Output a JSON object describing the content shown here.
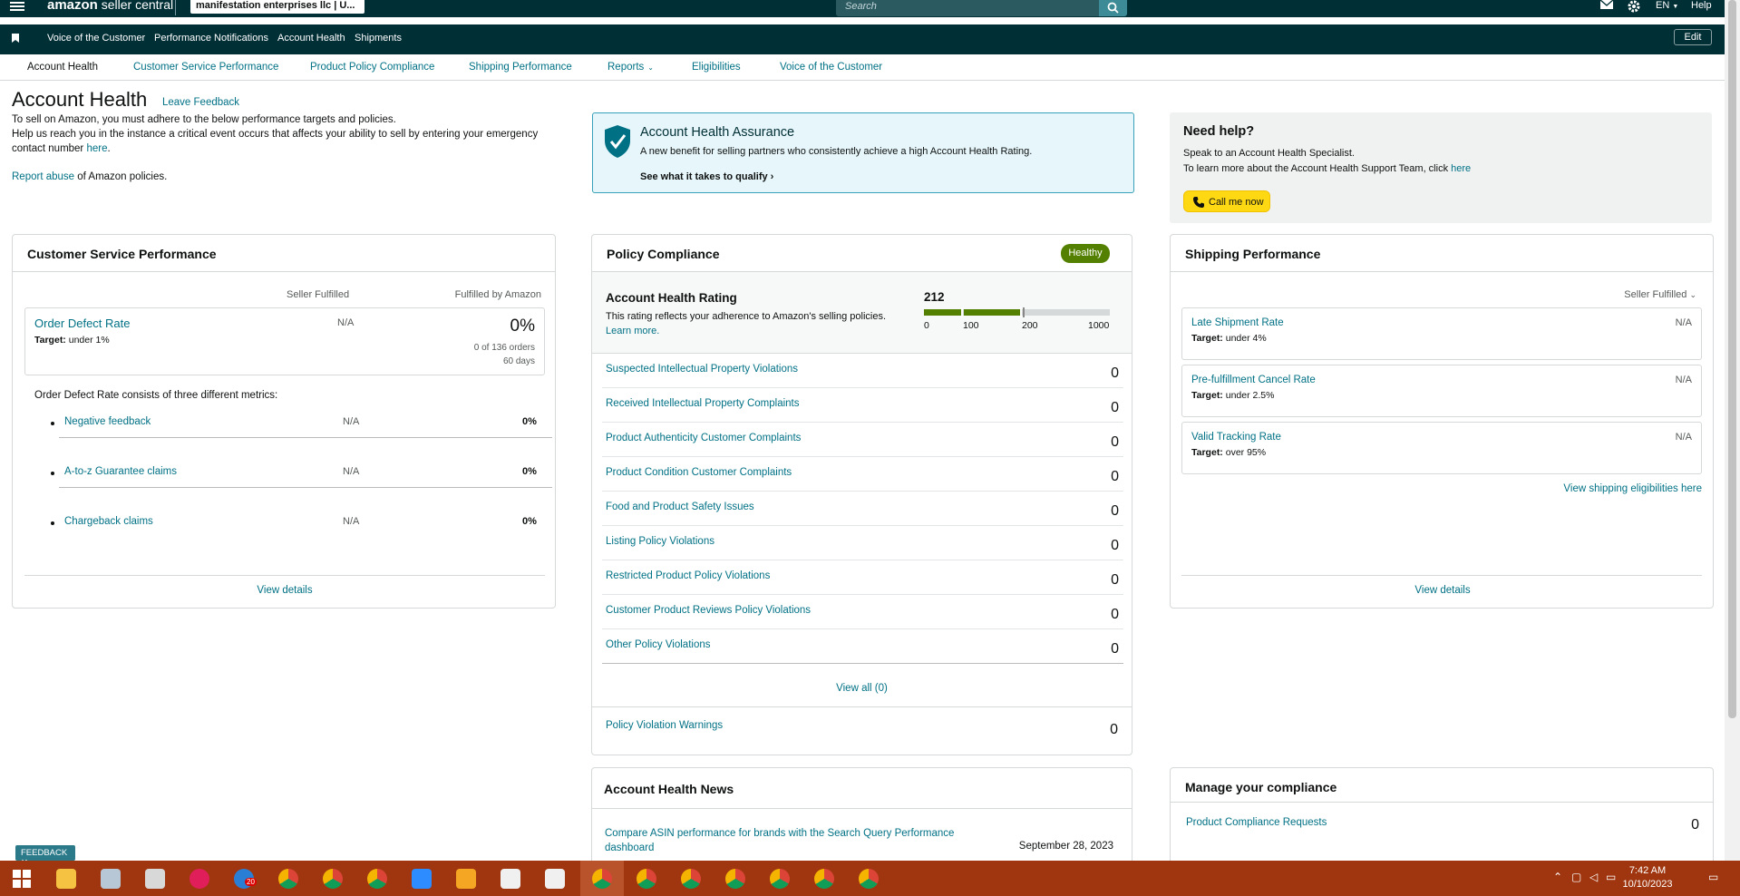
{
  "topbar": {
    "brand": "amazon",
    "brand_suffix": " seller central",
    "account": "manifestation enterprises llc | U...",
    "search_placeholder": "Search",
    "language": "EN",
    "help": "Help"
  },
  "subnav": {
    "items": [
      "Voice of the Customer",
      "Performance Notifications",
      "Account Health",
      "Shipments"
    ],
    "edit": "Edit"
  },
  "tabs": {
    "items": [
      "Account Health",
      "Customer Service Performance",
      "Product Policy Compliance",
      "Shipping Performance",
      "Reports",
      "Eligibilities",
      "Voice of the Customer"
    ]
  },
  "header": {
    "title": "Account Health",
    "leave_feedback": "Leave Feedback",
    "intro1": "To sell on Amazon, you must adhere to the below performance targets and policies.",
    "intro2": "Help us reach you in the instance a critical event occurs that affects your ability to sell by entering your emergency contact number ",
    "intro2_link": "here",
    "intro2_end": ".",
    "report_abuse_link": "Report abuse",
    "report_abuse_rest": " of Amazon policies."
  },
  "assurance": {
    "title": "Account Health Assurance",
    "desc": "A new benefit for selling partners who consistently achieve a high Account Health Rating.",
    "link": "See what it takes to qualify"
  },
  "needhelp": {
    "title": "Need help?",
    "line1": "Speak to an Account Health Specialist.",
    "line2": "To learn more about the Account Health Support Team, click ",
    "line2_link": "here",
    "call": "Call me now"
  },
  "csp": {
    "title": "Customer Service Performance",
    "col_seller": "Seller Fulfilled",
    "col_fba": "Fulfilled by Amazon",
    "odr_name": "Order Defect Rate",
    "odr_target_label": "Target:",
    "odr_target": " under 1%",
    "odr_na": "N/A",
    "odr_pct": "0%",
    "odr_orders": "0 of 136 orders",
    "odr_days": "60 days",
    "consists": "Order Defect Rate consists of three different metrics:",
    "metrics": [
      {
        "name": "Negative feedback",
        "seller": "N/A",
        "fba": "0%"
      },
      {
        "name": "A-to-z Guarantee claims",
        "seller": "N/A",
        "fba": "0%"
      },
      {
        "name": "Chargeback claims",
        "seller": "N/A",
        "fba": "0%"
      }
    ],
    "view_details": "View details"
  },
  "pc": {
    "title": "Policy Compliance",
    "status": "Healthy",
    "ahr_title": "Account Health Rating",
    "ahr_desc": "This rating reflects your adherence to Amazon's selling policies.",
    "ahr_learn": "Learn more.",
    "score": "212",
    "scale": [
      "0",
      "100",
      "200",
      "1000"
    ],
    "violations": [
      {
        "name": "Suspected Intellectual Property Violations",
        "count": "0"
      },
      {
        "name": "Received Intellectual Property Complaints",
        "count": "0"
      },
      {
        "name": "Product Authenticity Customer Complaints",
        "count": "0"
      },
      {
        "name": "Product Condition Customer Complaints",
        "count": "0"
      },
      {
        "name": "Food and Product Safety Issues",
        "count": "0"
      },
      {
        "name": "Listing Policy Violations",
        "count": "0"
      },
      {
        "name": "Restricted Product Policy Violations",
        "count": "0"
      },
      {
        "name": "Customer Product Reviews Policy Violations",
        "count": "0"
      },
      {
        "name": "Other Policy Violations",
        "count": "0"
      }
    ],
    "view_all": "View all (0)",
    "warnings": "Policy Violation Warnings",
    "warnings_count": "0"
  },
  "sp": {
    "title": "Shipping Performance",
    "filter": "Seller Fulfilled",
    "rows": [
      {
        "name": "Late Shipment Rate",
        "target_label": "Target:",
        "target": " under 4%",
        "value": "N/A"
      },
      {
        "name": "Pre-fulfillment Cancel Rate",
        "target_label": "Target:",
        "target": " under 2.5%",
        "value": "N/A"
      },
      {
        "name": "Valid Tracking Rate",
        "target_label": "Target:",
        "target": " over 95%",
        "value": "N/A"
      }
    ],
    "eligibilities": "View shipping eligibilities here",
    "view_details": "View details"
  },
  "news": {
    "title": "Account Health News",
    "item": "Compare ASIN performance for brands with the Search Query Performance dashboard",
    "date": "September 28, 2023"
  },
  "mc": {
    "title": "Manage your compliance",
    "item": "Product Compliance Requests",
    "count": "0"
  },
  "feedback": "FEEDBACK",
  "taskbar": {
    "time": "7:42 AM",
    "date": "10/10/2023",
    "badge": "20"
  }
}
